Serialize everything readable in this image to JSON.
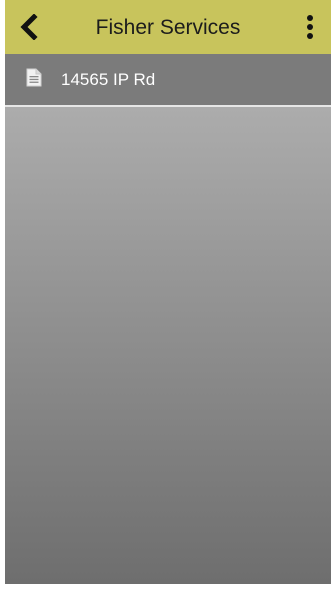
{
  "app_bar": {
    "title": "Fisher Services",
    "back_icon": "chevron-left-icon",
    "menu_icon": "more-vertical-icon",
    "background_color": "#c8c45c"
  },
  "list": {
    "items": [
      {
        "label": "14565 IP Rd",
        "icon": "document-icon"
      }
    ]
  }
}
